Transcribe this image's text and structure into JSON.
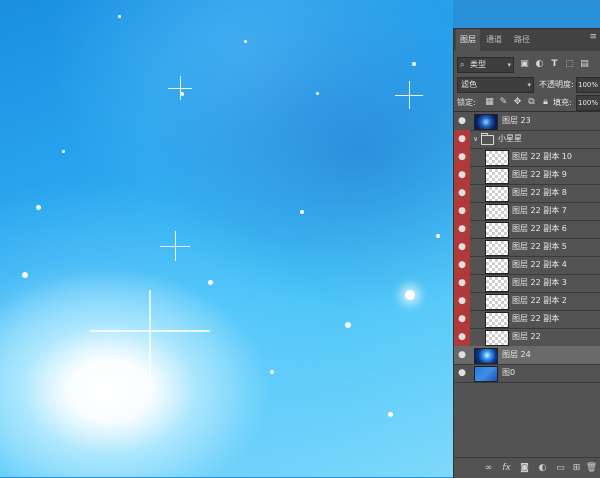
{
  "panel": {
    "tabs": [
      {
        "label": "图层"
      },
      {
        "label": "通道"
      },
      {
        "label": "路径"
      }
    ],
    "kind_filter": "类型",
    "blend_mode": "滤色",
    "opacity_label": "不透明度:",
    "opacity_value": "100%",
    "lock_label": "锁定:",
    "fill_label": "填充:",
    "fill_value": "100%",
    "layers": [
      {
        "name": "图层 23"
      },
      {
        "name": "小星星"
      },
      {
        "name": "图层 22 副本 10"
      },
      {
        "name": "图层 22 副本 9"
      },
      {
        "name": "图层 22 副本 8"
      },
      {
        "name": "图层 22 副本 7"
      },
      {
        "name": "图层 22 副本 6"
      },
      {
        "name": "图层 22 副本 5"
      },
      {
        "name": "图层 22 副本 4"
      },
      {
        "name": "图层 22 副本 3"
      },
      {
        "name": "图层 22 副本 2"
      },
      {
        "name": "图层 22 副本"
      },
      {
        "name": "图层 22"
      },
      {
        "name": "图层 24"
      },
      {
        "name": "图0"
      }
    ]
  },
  "colors": {
    "panel_bg": "#535353",
    "visibility_highlight": "#b03a3a",
    "selected_row": "#6a6a6a"
  }
}
